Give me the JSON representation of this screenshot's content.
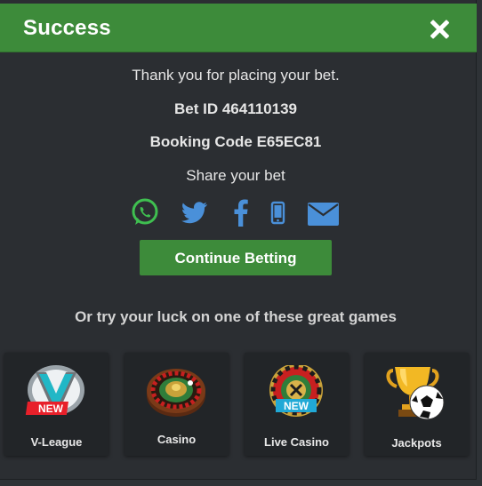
{
  "dialog": {
    "title": "Success",
    "thanks_text": "Thank you for placing your bet.",
    "bet_id_text": "Bet ID 464110139",
    "booking_code_text": "Booking Code E65EC81",
    "share_text": "Share your bet",
    "continue_label": "Continue Betting",
    "promo_text": "Or try your luck on one of these great games"
  },
  "share_icons": [
    "whatsapp-icon",
    "twitter-icon",
    "facebook-icon",
    "sms-icon",
    "email-icon"
  ],
  "games": [
    {
      "label": "V-League",
      "badge": "NEW"
    },
    {
      "label": "Casino"
    },
    {
      "label": "Live Casino",
      "badge": "NEW"
    },
    {
      "label": "Jackpots"
    }
  ],
  "colors": {
    "accent_green": "#3d8b3a",
    "background": "#2b2e32",
    "share_icon_blue": "#4a90d9",
    "whatsapp_green": "#3fbf50"
  }
}
